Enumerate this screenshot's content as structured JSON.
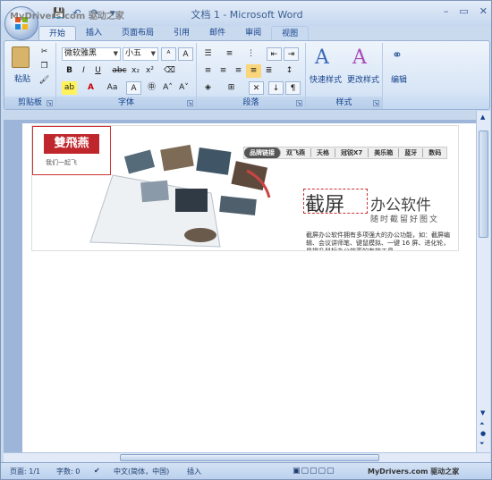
{
  "window": {
    "title": "文档 1 - Microsoft Word",
    "watermark_top": "MyDrivers.com 驱动之家"
  },
  "qat": [
    "save-icon",
    "undo-icon",
    "redo-icon",
    "customize-icon"
  ],
  "tabs": [
    {
      "label": "开始"
    },
    {
      "label": "插入"
    },
    {
      "label": "页面布局"
    },
    {
      "label": "引用"
    },
    {
      "label": "邮件"
    },
    {
      "label": "审阅"
    },
    {
      "label": "视图"
    }
  ],
  "ribbon": {
    "clipboard": {
      "paste": "粘贴",
      "group": "剪贴板"
    },
    "font": {
      "name": "微软雅黑",
      "size": "小五",
      "group": "字体"
    },
    "paragraph": {
      "group": "段落"
    },
    "styles": {
      "quick": "快速样式",
      "change": "更改样式",
      "group": "样式"
    },
    "editing": {
      "label": "编辑"
    }
  },
  "document": {
    "brand": "雙飛燕",
    "brand_sub": "我们一起飞",
    "nav": [
      "品牌链接",
      "双飞燕",
      "天格",
      "冠锐X7",
      "美乐箱",
      "蓝牙",
      "数码"
    ],
    "headline": "截屏",
    "headline_tail": "办公软件",
    "subhead": "随时截留好图文",
    "description": "截屏办公软件拥有多项强大的办公功能，如：截屏编辑、会议讲师笔、键鼠模拟、一键 16 屏、进化轮，是提升鼠标办公效率的有效工具。"
  },
  "status": {
    "page": "页面: 1/1",
    "words": "字数: 0",
    "lang": "中文(简体，中国)",
    "mode": "插入",
    "watermark": "MyDrivers.com 驱动之家"
  }
}
